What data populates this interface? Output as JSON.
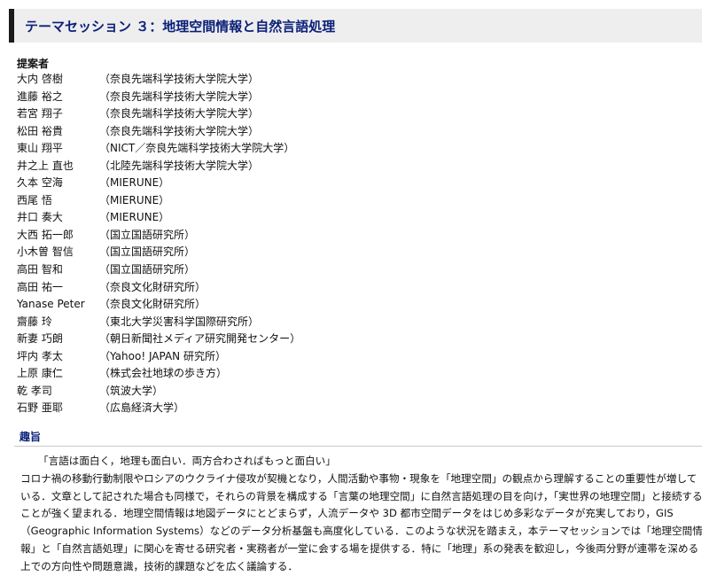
{
  "session": {
    "title": "テーマセッション ３：地理空間情報と自然言語処理"
  },
  "proposers": {
    "label": "提案者",
    "list": [
      {
        "name": "大内 啓樹",
        "affiliation": "（奈良先端科学技術大学院大学）"
      },
      {
        "name": "進藤 裕之",
        "affiliation": "（奈良先端科学技術大学院大学）"
      },
      {
        "name": "若宮 翔子",
        "affiliation": "（奈良先端科学技術大学院大学）"
      },
      {
        "name": "松田 裕貴",
        "affiliation": "（奈良先端科学技術大学院大学）"
      },
      {
        "name": "東山 翔平",
        "affiliation": "（NICT／奈良先端科学技術大学院大学）"
      },
      {
        "name": "井之上 直也",
        "affiliation": "（北陸先端科学技術大学院大学）"
      },
      {
        "name": "久本 空海",
        "affiliation": "（MIERUNE）"
      },
      {
        "name": "西尾 悟",
        "affiliation": "（MIERUNE）"
      },
      {
        "name": "井口 奏大",
        "affiliation": "（MIERUNE）"
      },
      {
        "name": "大西 拓一郎",
        "affiliation": "（国立国語研究所）"
      },
      {
        "name": "小木曽 智信",
        "affiliation": "（国立国語研究所）"
      },
      {
        "name": "高田 智和",
        "affiliation": "（国立国語研究所）"
      },
      {
        "name": "高田 祐一",
        "affiliation": "（奈良文化財研究所）"
      },
      {
        "name": "Yanase Peter",
        "affiliation": "（奈良文化財研究所）"
      },
      {
        "name": "齋藤 玲",
        "affiliation": "（東北大学災害科学国際研究所）"
      },
      {
        "name": "新妻 巧朗",
        "affiliation": "（朝日新聞社メディア研究開発センター）"
      },
      {
        "name": "坪内 孝太",
        "affiliation": "（Yahoo! JAPAN 研究所）"
      },
      {
        "name": "上原 康仁",
        "affiliation": "（株式会社地球の歩き方）"
      },
      {
        "name": "乾 孝司",
        "affiliation": "（筑波大学）"
      },
      {
        "name": "石野 亜耶",
        "affiliation": "（広島経済大学）"
      }
    ]
  },
  "summary": {
    "label": "趣旨",
    "quote": "「言語は面白く，地理も面白い．両方合わさればもっと面白い」",
    "body": "コロナ禍の移動行動制限やロシアのウクライナ侵攻が契機となり，人間活動や事物・現象を「地理空間」の観点から理解することの重要性が増している．文章として記された場合も同様で，それらの背景を構成する「言葉の地理空間」に自然言語処理の目を向け，「実世界の地理空間」と接続することが強く望まれる．地理空間情報は地図データにとどまらず，人流データや 3D 都市空間データをはじめ多彩なデータが充実しており，GIS（Geographic Information Systems）などのデータ分析基盤も高度化している．このような状況を踏まえ，本テーマセッションでは「地理空間情報」と「自然言語処理」に関心を寄せる研究者・実務者が一堂に会する場を提供する．特に「地理」系の発表を歓迎し，今後両分野が連帯を深める上での方向性や問題意識，技術的課題などを広く議論する．"
  }
}
